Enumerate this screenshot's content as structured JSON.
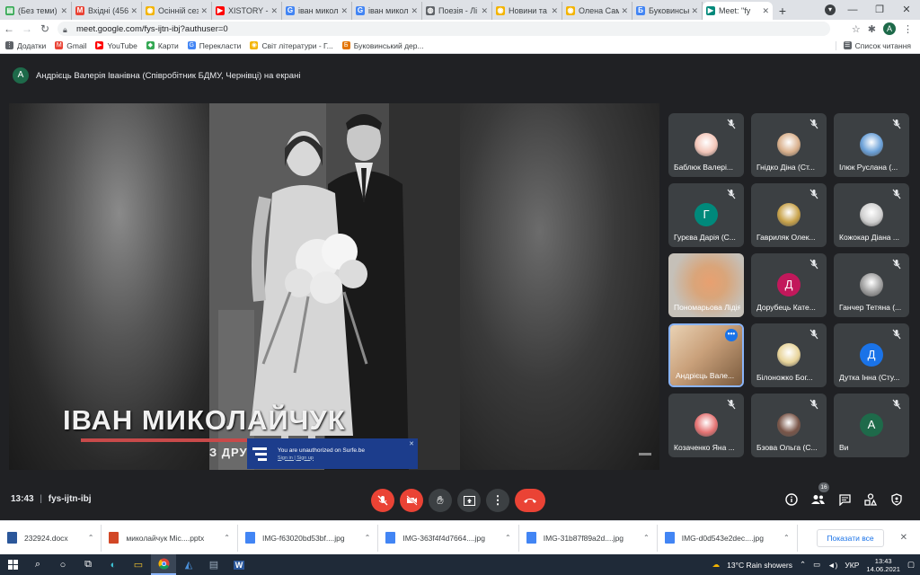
{
  "browser": {
    "tabs": [
      {
        "title": "(Без теми) -",
        "color": "#34a853",
        "glyph": "▤"
      },
      {
        "title": "Вхідні (456)",
        "color": "#ea4335",
        "glyph": "M"
      },
      {
        "title": "Осінній сезо",
        "color": "#f4b400",
        "glyph": "◉"
      },
      {
        "title": "XISTORY - В",
        "color": "#ff0000",
        "glyph": "▶"
      },
      {
        "title": "іван микола",
        "color": "#4285f4",
        "glyph": "G"
      },
      {
        "title": "іван микол",
        "color": "#4285f4",
        "glyph": "G"
      },
      {
        "title": "Поезія - Лі",
        "color": "#5f6368",
        "glyph": "◍"
      },
      {
        "title": "Новини та",
        "color": "#f4b400",
        "glyph": "◉"
      },
      {
        "title": "Олена Самч",
        "color": "#f4b400",
        "glyph": "◉"
      },
      {
        "title": "Буковинськ",
        "color": "#4285f4",
        "glyph": "Б"
      },
      {
        "title": "Meet: \"fy",
        "color": "#00897b",
        "glyph": "▶",
        "active": true
      }
    ],
    "url": "meet.google.com/fys-ijtn-ibj?authuser=0",
    "profile_initial": "A",
    "bookmarks": [
      {
        "label": "Додатки",
        "color": "#5f6368",
        "glyph": "⋮"
      },
      {
        "label": "Gmail",
        "color": "#ea4335",
        "glyph": "M"
      },
      {
        "label": "YouTube",
        "color": "#ff0000",
        "glyph": "▶"
      },
      {
        "label": "Карти",
        "color": "#34a853",
        "glyph": "◆"
      },
      {
        "label": "Перекласти",
        "color": "#4285f4",
        "glyph": "G"
      },
      {
        "label": "Світ літератури - Г...",
        "color": "#f4b400",
        "glyph": "◉"
      },
      {
        "label": "Буковинський дер...",
        "color": "#e37400",
        "glyph": "Б"
      }
    ],
    "reading_list": "Список читання"
  },
  "meet": {
    "presenter": {
      "initial": "A",
      "text": "Андрієць Валерія Іванівна (Співробітник БДМУ, Чернівці) на екрані"
    },
    "slide": {
      "title": "ІВАН МИКОЛАЙЧУК",
      "subtitle": "З ДРУ",
      "surfe_line1": "You are unauthorized on Surfe.be",
      "surfe_line2": "Sign in | Sign up"
    },
    "participants": [
      {
        "name": "Баблюк Валері...",
        "type": "img",
        "color": "#f3c6b9"
      },
      {
        "name": "Гнідко Діна (Ст...",
        "type": "img",
        "color": "#d9b08c"
      },
      {
        "name": "Ілюк Руслана (...",
        "type": "img",
        "color": "#6aa0d8"
      },
      {
        "name": "Гурєва Дарія (С...",
        "type": "letter",
        "letter": "Г",
        "color": "#00897b"
      },
      {
        "name": "Гавриляк Олек...",
        "type": "img",
        "color": "#c8a24a"
      },
      {
        "name": "Кожокар Діана ...",
        "type": "img",
        "color": "#d0d0d0"
      },
      {
        "name": "Пономарьова Лідія...",
        "type": "video",
        "color": "#d9a57a"
      },
      {
        "name": "Дорубець Кате...",
        "type": "letter",
        "letter": "Д",
        "color": "#c2185b"
      },
      {
        "name": "Ганчер Тетяна (...",
        "type": "img",
        "color": "#9e9e9e"
      },
      {
        "name": "Андрієць Вале...",
        "type": "self",
        "color": "#c9a07a"
      },
      {
        "name": "Білоножко Бог...",
        "type": "img",
        "color": "#e8d49a"
      },
      {
        "name": "Дутка Інна (Сту...",
        "type": "letter",
        "letter": "Д",
        "color": "#1a73e8"
      },
      {
        "name": "Козаченко Яна ...",
        "type": "img",
        "color": "#e57373"
      },
      {
        "name": "Бзова Ольга (С...",
        "type": "img",
        "color": "#795548"
      },
      {
        "name": "Ви",
        "type": "letter",
        "letter": "A",
        "color": "#1e6a4a"
      }
    ],
    "clock": "13:43",
    "meeting_code": "fys-ijtn-ibj",
    "people_count": "16"
  },
  "downloads": {
    "items": [
      {
        "name": "232924.docx",
        "color": "#2b579a"
      },
      {
        "name": "миколайчук Mic....pptx",
        "color": "#d24726"
      },
      {
        "name": "IMG-f63020bd53bf....jpg",
        "color": "#4285f4"
      },
      {
        "name": "IMG-363f4f4d7664....jpg",
        "color": "#4285f4"
      },
      {
        "name": "IMG-31b87f89a2d....jpg",
        "color": "#4285f4"
      },
      {
        "name": "IMG-d0d543e2dec....jpg",
        "color": "#4285f4"
      }
    ],
    "show_all": "Показати все"
  },
  "taskbar": {
    "weather": "13°C  Rain showers",
    "lang": "УКР",
    "time": "13:43",
    "date": "14.06.2021"
  }
}
